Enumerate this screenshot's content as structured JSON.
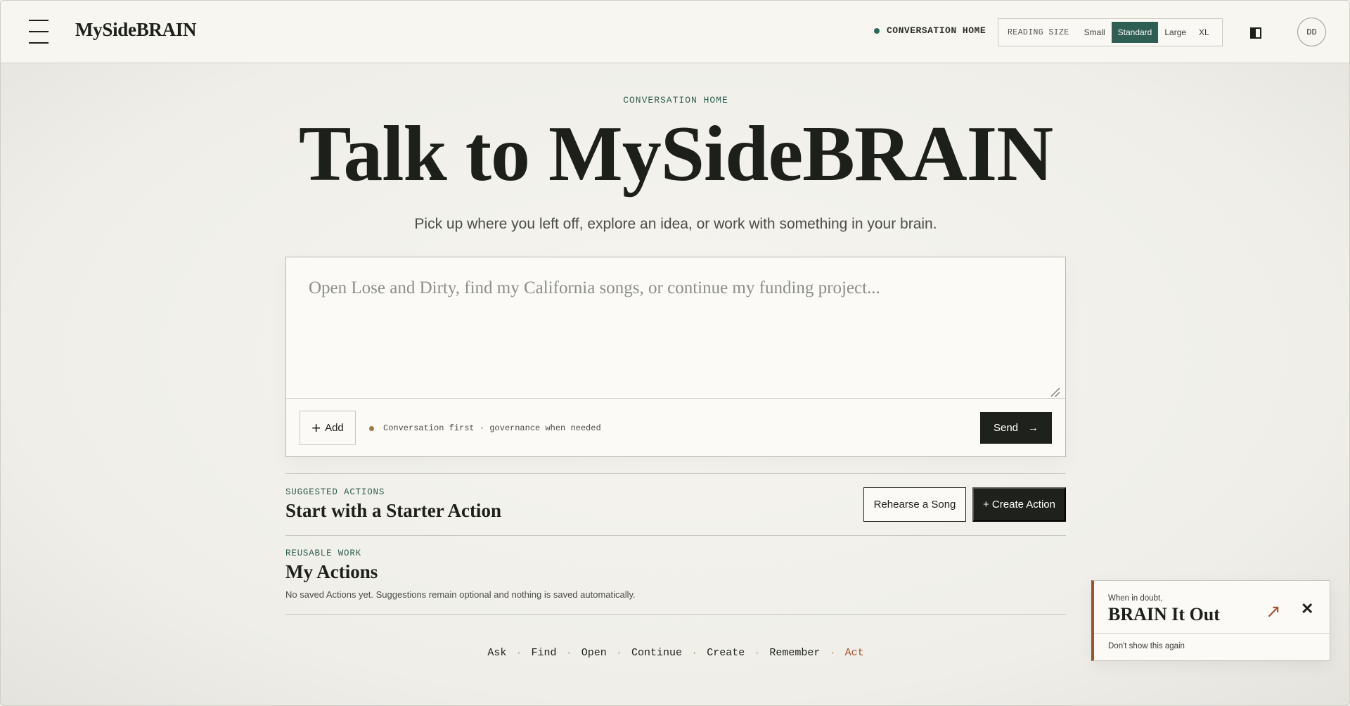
{
  "header": {
    "brand": "MySideBRAIN",
    "status_label": "CONVERSATION HOME",
    "reading_size": {
      "label": "READING SIZE",
      "options": [
        "Small",
        "Standard",
        "Large",
        "XL"
      ],
      "selected": "Standard"
    },
    "avatar_initials": "DD"
  },
  "hero": {
    "eyebrow": "CONVERSATION HOME",
    "title": "Talk to MySideBRAIN",
    "subtitle": "Pick up where you left off, explore an idea, or work with something in your brain."
  },
  "composer": {
    "value": "",
    "placeholder": "Open Lose and Dirty, find my California songs, or continue my funding project...",
    "add_label": "Add",
    "mode_text": "Conversation first · governance when needed",
    "send_label": "Send",
    "send_arrow": "→"
  },
  "suggested": {
    "eyebrow": "SUGGESTED ACTIONS",
    "title": "Start with a Starter Action",
    "rehearse_label": "Rehearse a Song",
    "create_label": "+ Create Action"
  },
  "my_actions": {
    "eyebrow": "REUSABLE WORK",
    "title": "My Actions",
    "description": "No saved Actions yet. Suggestions remain optional and nothing is saved automatically."
  },
  "verbs": [
    "Ask",
    "Find",
    "Open",
    "Continue",
    "Create",
    "Remember",
    "Act"
  ],
  "toast": {
    "kicker": "When in doubt,",
    "headline": "BRAIN It Out",
    "arrow": "↗",
    "close": "✕",
    "dismiss_label": "Don't show this again"
  },
  "colors": {
    "accent_green": "#2f5e52",
    "accent_rust": "#a0522d",
    "accent_gold": "#a07a3e",
    "dark_button": "#1f211d"
  },
  "icons": {
    "menu": "hamburger-icon",
    "panel": "panel-toggle-icon",
    "add": "plus-icon",
    "send": "arrow-right-icon",
    "toast_open": "arrow-up-right-icon",
    "toast_close": "close-icon"
  }
}
